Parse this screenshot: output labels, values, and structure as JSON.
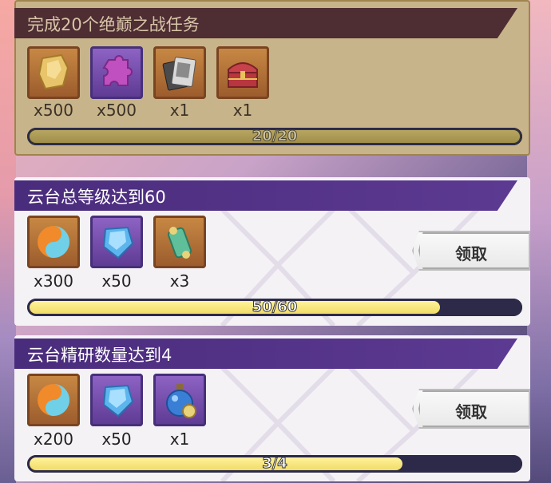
{
  "tasks": [
    {
      "title": "完成20个绝巅之战任务",
      "state": "completed",
      "rewards": [
        {
          "icon": "gold-crystal-icon",
          "qty": "x500"
        },
        {
          "icon": "purple-puzzle-icon",
          "qty": "x500"
        },
        {
          "icon": "card-pack-icon",
          "qty": "x1"
        },
        {
          "icon": "treasure-chest-icon",
          "qty": "x1"
        }
      ],
      "progress_text": "20/20",
      "progress": 1.0
    },
    {
      "title": "云台总等级达到60",
      "rewards": [
        {
          "icon": "fire-water-orb-icon",
          "qty": "x300"
        },
        {
          "icon": "blue-crystal-icon",
          "qty": "x50"
        },
        {
          "icon": "jade-scroll-icon",
          "qty": "x3"
        }
      ],
      "progress_text": "50/60",
      "progress": 0.833,
      "claim_label": "领取"
    },
    {
      "title": "云台精研数量达到4",
      "rewards": [
        {
          "icon": "fire-water-orb-icon",
          "qty": "x200"
        },
        {
          "icon": "blue-crystal-icon",
          "qty": "x50"
        },
        {
          "icon": "potion-flask-icon",
          "qty": "x1"
        }
      ],
      "progress_text": "3/4",
      "progress": 0.75,
      "claim_label": "领取"
    }
  ],
  "colors": {
    "header_purple": "#4a2c7c",
    "bar_fill": "#f1dc66",
    "bar_track": "#2c2a48",
    "completed_tint": "#d9c79f"
  }
}
